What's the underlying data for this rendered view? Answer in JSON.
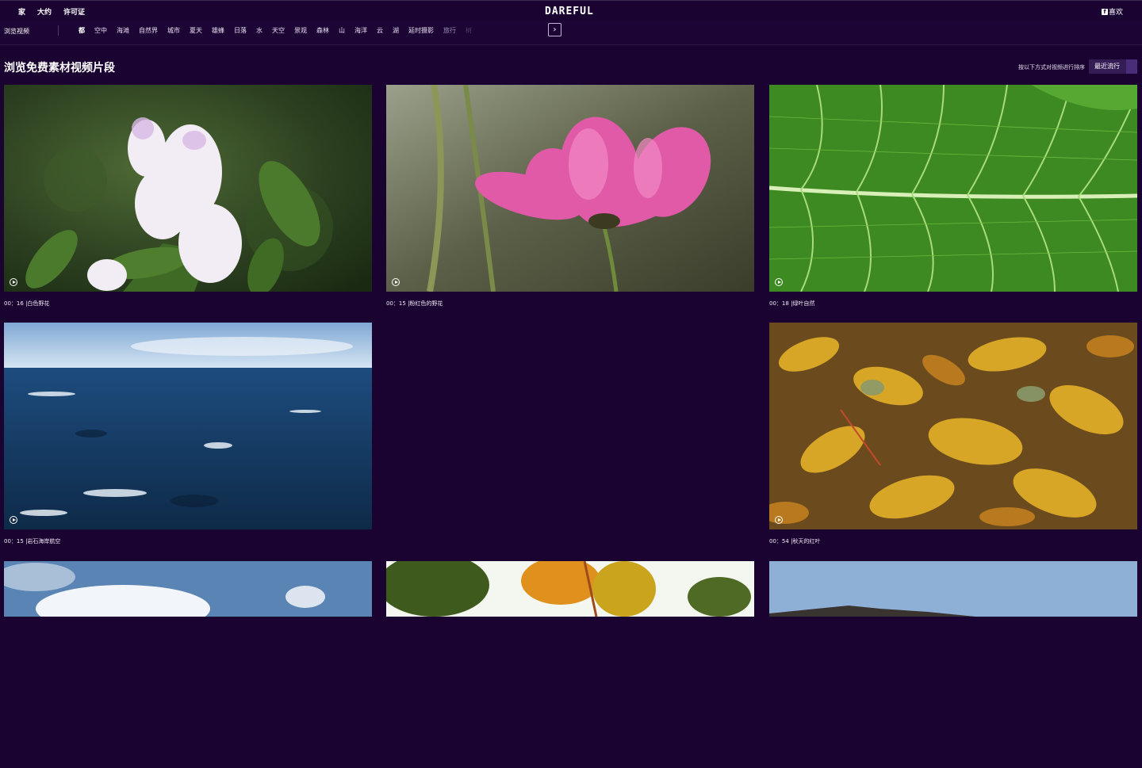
{
  "header": {
    "nav": [
      "家",
      "大约",
      "许可证"
    ],
    "logo": "DAREFUL",
    "like_label": "喜欢"
  },
  "categories": {
    "title": "浏览视频",
    "items": [
      "都",
      "空中",
      "海滩",
      "自然界",
      "城市",
      "夏天",
      "雄蜂",
      "日落",
      "水",
      "天空",
      "景观",
      "森林",
      "山",
      "海洋",
      "云",
      "湖",
      "延时摄影",
      "旅行",
      "树"
    ],
    "active_index": 0
  },
  "main": {
    "title": "浏览免费素材视频片段",
    "sort_label": "按以下方式对视频进行排序",
    "sort_value": "最近流行"
  },
  "videos": [
    {
      "duration": "00：16",
      "title": "白色野花"
    },
    {
      "duration": "00：15",
      "title": "粉红色的野花"
    },
    {
      "duration": "00：18",
      "title": "绿叶自然"
    },
    {
      "duration": "00：15",
      "title": "岩石海岸航空"
    },
    {
      "duration": "00：54",
      "title": "秋天的红叶"
    }
  ],
  "colors": {
    "background": "#1a0330",
    "accent": "#4a2d78"
  }
}
